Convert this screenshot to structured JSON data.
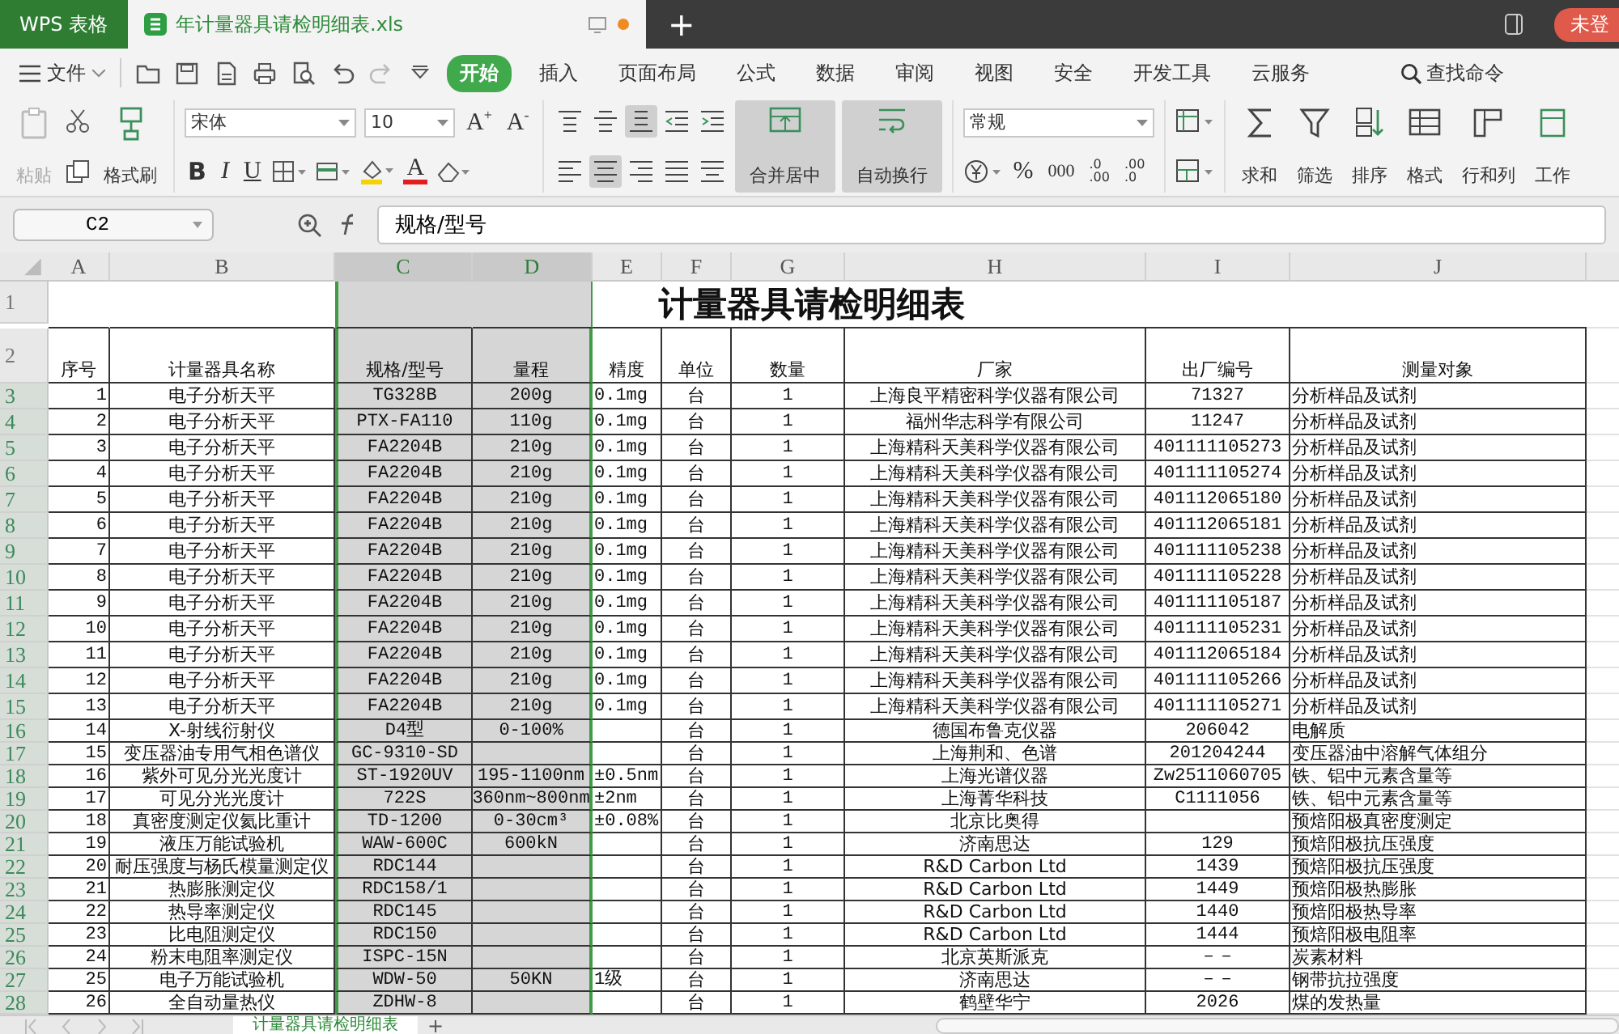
{
  "app_tabs": [
    {
      "label": "WPS 表格",
      "kind": "app",
      "selected": false
    },
    {
      "label": "年计量器具请检明细表.xls",
      "kind": "document",
      "selected": true
    }
  ],
  "new_tab": "+",
  "account": "未登",
  "menu": {
    "file": "文件",
    "items": [
      {
        "label": "开始",
        "selected": true
      },
      {
        "label": "插入",
        "selected": false
      },
      {
        "label": "页面布局",
        "selected": false
      },
      {
        "label": "公式",
        "selected": false
      },
      {
        "label": "数据",
        "selected": false
      },
      {
        "label": "审阅",
        "selected": false
      },
      {
        "label": "视图",
        "selected": false
      },
      {
        "label": "安全",
        "selected": false
      },
      {
        "label": "开发工具",
        "selected": false
      },
      {
        "label": "云服务",
        "selected": false
      }
    ],
    "search": "查找命令"
  },
  "ribbon": {
    "clipboard": [
      {
        "kind": "paste",
        "label": "粘贴",
        "disabled": true
      },
      {
        "kind": "painter",
        "label": "格式刷",
        "disabled": false
      }
    ],
    "font_name": "宋体",
    "font_size": "10",
    "font_buttons": [
      "A$^{+}$",
      "A$^{-}$"
    ],
    "style_buttons": [
      {
        "kind": "bold",
        "label": "B"
      },
      {
        "kind": "italic",
        "label": "I"
      },
      {
        "kind": "underline",
        "label": "U"
      }
    ],
    "font_color": "A",
    "align": [
      {
        "kind": "top",
        "selected": false
      },
      {
        "kind": "middle",
        "selected": false
      },
      {
        "kind": "bottom",
        "selected": true
      },
      {
        "kind": "outdent",
        "selected": false
      },
      {
        "kind": "indent",
        "selected": false
      },
      {
        "kind": "left",
        "selected": false
      },
      {
        "kind": "center",
        "selected": true
      },
      {
        "kind": "right",
        "selected": false
      },
      {
        "kind": "justify",
        "selected": false
      },
      {
        "kind": "distributed",
        "selected": false
      }
    ],
    "merge": {
      "label": "合并居中",
      "selected": true
    },
    "wrap": {
      "label": "自动换行",
      "selected": true
    },
    "number_format": "常规",
    "number_buttons": [
      "%",
      "000"
    ],
    "decimal_buttons": [
      [
        ".0",
        ".00"
      ],
      [
        ".00",
        ".0"
      ]
    ],
    "tools": [
      {
        "kind": "sum",
        "label": "求和"
      },
      {
        "kind": "filter",
        "label": "筛选"
      },
      {
        "kind": "sort",
        "label": "排序"
      },
      {
        "kind": "format",
        "label": "格式"
      },
      {
        "kind": "rowcol",
        "label": "行和列"
      },
      {
        "kind": "sheet",
        "label": "工作"
      }
    ]
  },
  "formula_bar": {
    "name_box": "C2",
    "value": "规格/型号"
  },
  "sheet": {
    "columns": [
      {
        "letter": "A",
        "selected": false
      },
      {
        "letter": "B",
        "selected": false
      },
      {
        "letter": "C",
        "selected": true
      },
      {
        "letter": "D",
        "selected": true
      },
      {
        "letter": "E",
        "selected": false
      },
      {
        "letter": "F",
        "selected": false
      },
      {
        "letter": "G",
        "selected": false
      },
      {
        "letter": "H",
        "selected": false
      },
      {
        "letter": "I",
        "selected": false
      },
      {
        "letter": "J",
        "selected": false
      }
    ],
    "title_row": {
      "row": "1",
      "selected": false,
      "title": "计量器具请检明细表"
    },
    "header_row": {
      "row": "2",
      "selected": false,
      "cells": [
        "序号",
        "计量器具名称",
        "规格/型号",
        "量程",
        "精度",
        "单位",
        "数量",
        "厂家",
        "出厂编号",
        "测量对象"
      ]
    },
    "rows": [
      {
        "row": "3",
        "selected": true,
        "cells": [
          "1",
          "电子分析天平",
          "TG328B",
          "200g",
          "0.1mg",
          "台",
          "1",
          "上海良平精密科学仪器有限公司",
          "71327",
          "分析样品及试剂"
        ]
      },
      {
        "row": "4",
        "selected": true,
        "cells": [
          "2",
          "电子分析天平",
          "PTX-FA110",
          "110g",
          "0.1mg",
          "台",
          "1",
          "福州华志科学有限公司",
          "11247",
          "分析样品及试剂"
        ]
      },
      {
        "row": "5",
        "selected": true,
        "cells": [
          "3",
          "电子分析天平",
          "FA2204B",
          "210g",
          "0.1mg",
          "台",
          "1",
          "上海精科天美科学仪器有限公司",
          "401111105273",
          "分析样品及试剂"
        ]
      },
      {
        "row": "6",
        "selected": true,
        "cells": [
          "4",
          "电子分析天平",
          "FA2204B",
          "210g",
          "0.1mg",
          "台",
          "1",
          "上海精科天美科学仪器有限公司",
          "401111105274",
          "分析样品及试剂"
        ]
      },
      {
        "row": "7",
        "selected": true,
        "cells": [
          "5",
          "电子分析天平",
          "FA2204B",
          "210g",
          "0.1mg",
          "台",
          "1",
          "上海精科天美科学仪器有限公司",
          "401112065180",
          "分析样品及试剂"
        ]
      },
      {
        "row": "8",
        "selected": true,
        "cells": [
          "6",
          "电子分析天平",
          "FA2204B",
          "210g",
          "0.1mg",
          "台",
          "1",
          "上海精科天美科学仪器有限公司",
          "401112065181",
          "分析样品及试剂"
        ]
      },
      {
        "row": "9",
        "selected": true,
        "cells": [
          "7",
          "电子分析天平",
          "FA2204B",
          "210g",
          "0.1mg",
          "台",
          "1",
          "上海精科天美科学仪器有限公司",
          "401111105238",
          "分析样品及试剂"
        ]
      },
      {
        "row": "10",
        "selected": true,
        "cells": [
          "8",
          "电子分析天平",
          "FA2204B",
          "210g",
          "0.1mg",
          "台",
          "1",
          "上海精科天美科学仪器有限公司",
          "401111105228",
          "分析样品及试剂"
        ]
      },
      {
        "row": "11",
        "selected": true,
        "cells": [
          "9",
          "电子分析天平",
          "FA2204B",
          "210g",
          "0.1mg",
          "台",
          "1",
          "上海精科天美科学仪器有限公司",
          "401111105187",
          "分析样品及试剂"
        ]
      },
      {
        "row": "12",
        "selected": true,
        "cells": [
          "10",
          "电子分析天平",
          "FA2204B",
          "210g",
          "0.1mg",
          "台",
          "1",
          "上海精科天美科学仪器有限公司",
          "401111105231",
          "分析样品及试剂"
        ]
      },
      {
        "row": "13",
        "selected": true,
        "cells": [
          "11",
          "电子分析天平",
          "FA2204B",
          "210g",
          "0.1mg",
          "台",
          "1",
          "上海精科天美科学仪器有限公司",
          "401112065184",
          "分析样品及试剂"
        ]
      },
      {
        "row": "14",
        "selected": true,
        "cells": [
          "12",
          "电子分析天平",
          "FA2204B",
          "210g",
          "0.1mg",
          "台",
          "1",
          "上海精科天美科学仪器有限公司",
          "401111105266",
          "分析样品及试剂"
        ]
      },
      {
        "row": "15",
        "selected": true,
        "cells": [
          "13",
          "电子分析天平",
          "FA2204B",
          "210g",
          "0.1mg",
          "台",
          "1",
          "上海精科天美科学仪器有限公司",
          "401111105271",
          "分析样品及试剂"
        ]
      },
      {
        "row": "16",
        "selected": true,
        "cells": [
          "14",
          "X-射线衍射仪",
          "D4型",
          "0-100%",
          "",
          "台",
          "1",
          "德国布鲁克仪器",
          "206042",
          "电解质"
        ]
      },
      {
        "row": "17",
        "selected": true,
        "cells": [
          "15",
          "变压器油专用气相色谱仪",
          "GC-9310-SD",
          "",
          "",
          "台",
          "1",
          "上海荆和、色谱",
          "201204244",
          "变压器油中溶解气体组分"
        ]
      },
      {
        "row": "18",
        "selected": true,
        "cells": [
          "16",
          "紫外可见分光光度计",
          "ST-1920UV",
          "195-1100nm",
          "±0.5nm",
          "台",
          "1",
          "上海光谱仪器",
          "Zw2511060705",
          "铁、铝中元素含量等"
        ]
      },
      {
        "row": "19",
        "selected": true,
        "cells": [
          "17",
          "可见分光光度计",
          "722S",
          "360nm~800nm",
          "±2nm",
          "台",
          "1",
          "上海菁华科技",
          "C1111056",
          "铁、铝中元素含量等"
        ]
      },
      {
        "row": "20",
        "selected": true,
        "cells": [
          "18",
          "真密度测定仪氦比重计",
          "TD-1200",
          "0-30cm³",
          "±0.08%",
          "台",
          "1",
          "北京比奥得",
          "",
          "预焙阳极真密度测定"
        ]
      },
      {
        "row": "21",
        "selected": true,
        "cells": [
          "19",
          "液压万能试验机",
          "WAW-600C",
          "600kN",
          "",
          "台",
          "1",
          "济南思达",
          "129",
          "预焙阳极抗压强度"
        ]
      },
      {
        "row": "22",
        "selected": true,
        "cells": [
          "20",
          "耐压强度与杨氏模量测定仪",
          "RDC144",
          "",
          "",
          "台",
          "1",
          "R&D Carbon Ltd",
          "1439",
          "预焙阳极抗压强度"
        ]
      },
      {
        "row": "23",
        "selected": true,
        "cells": [
          "21",
          "热膨胀测定仪",
          "RDC158/1",
          "",
          "",
          "台",
          "1",
          "R&D Carbon Ltd",
          "1449",
          "预焙阳极热膨胀"
        ]
      },
      {
        "row": "24",
        "selected": true,
        "cells": [
          "22",
          "热导率测定仪",
          "RDC145",
          "",
          "",
          "台",
          "1",
          "R&D Carbon Ltd",
          "1440",
          "预焙阳极热导率"
        ]
      },
      {
        "row": "25",
        "selected": true,
        "cells": [
          "23",
          "比电阻测定仪",
          "RDC150",
          "",
          "",
          "台",
          "1",
          "R&D Carbon Ltd",
          "1444",
          "预焙阳极电阻率"
        ]
      },
      {
        "row": "26",
        "selected": true,
        "cells": [
          "24",
          "粉末电阻率测定仪",
          "ISPC-15N",
          "",
          "",
          "台",
          "1",
          "北京英斯派克",
          "－－",
          "炭素材料"
        ]
      },
      {
        "row": "27",
        "selected": true,
        "cells": [
          "25",
          "电子万能试验机",
          "WDW-50",
          "50KN",
          "1级",
          "台",
          "1",
          "济南思达",
          "－－",
          "钢带抗拉强度"
        ]
      },
      {
        "row": "28",
        "selected": true,
        "cells": [
          "26",
          "全自动量热仪",
          "ZDHW-8",
          "",
          "",
          "台",
          "1",
          "鹤壁华宁",
          "2026",
          "煤的发热量"
        ]
      }
    ]
  },
  "sheet_tabs": [
    {
      "label": "计量器具请检明细表",
      "selected": true
    }
  ],
  "add_sheet": "+"
}
